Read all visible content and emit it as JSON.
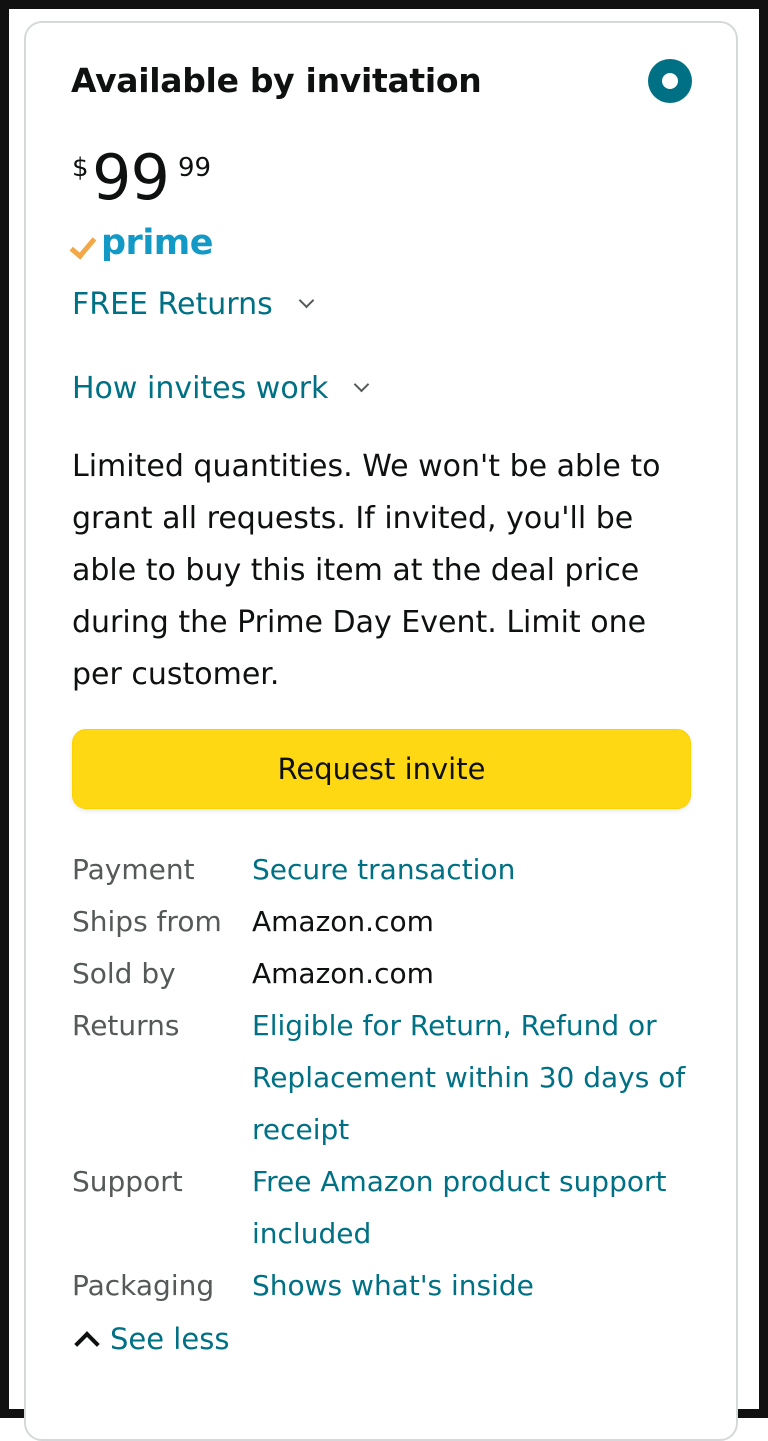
{
  "offer": {
    "title": "Available by invitation",
    "selected": true,
    "accent_color": "#007185",
    "price": {
      "symbol": "$",
      "whole": "99",
      "fraction": "99"
    },
    "prime_label": "prime",
    "free_returns_label": "FREE Returns",
    "how_invites_label": "How invites work",
    "description": "Limited quantities. We won't be able to grant all requests. If invited, you'll be able to buy this item at the deal price during the Prime Day Event. Limit one per customer.",
    "request_button_label": "Request invite",
    "button_color": "#FFD814"
  },
  "details": [
    {
      "label": "Payment",
      "value": "Secure transaction"
    },
    {
      "label": "Ships from",
      "value": "Amazon.com"
    },
    {
      "label": "Sold by",
      "value": "Amazon.com"
    },
    {
      "label": "Returns",
      "value": "Eligible for Return, Refund or Replacement within 30 days of receipt"
    },
    {
      "label": "Support",
      "value": "Free Amazon product support included"
    },
    {
      "label": "Packaging",
      "value": "Shows what's inside"
    }
  ],
  "see_less_label": "See less"
}
